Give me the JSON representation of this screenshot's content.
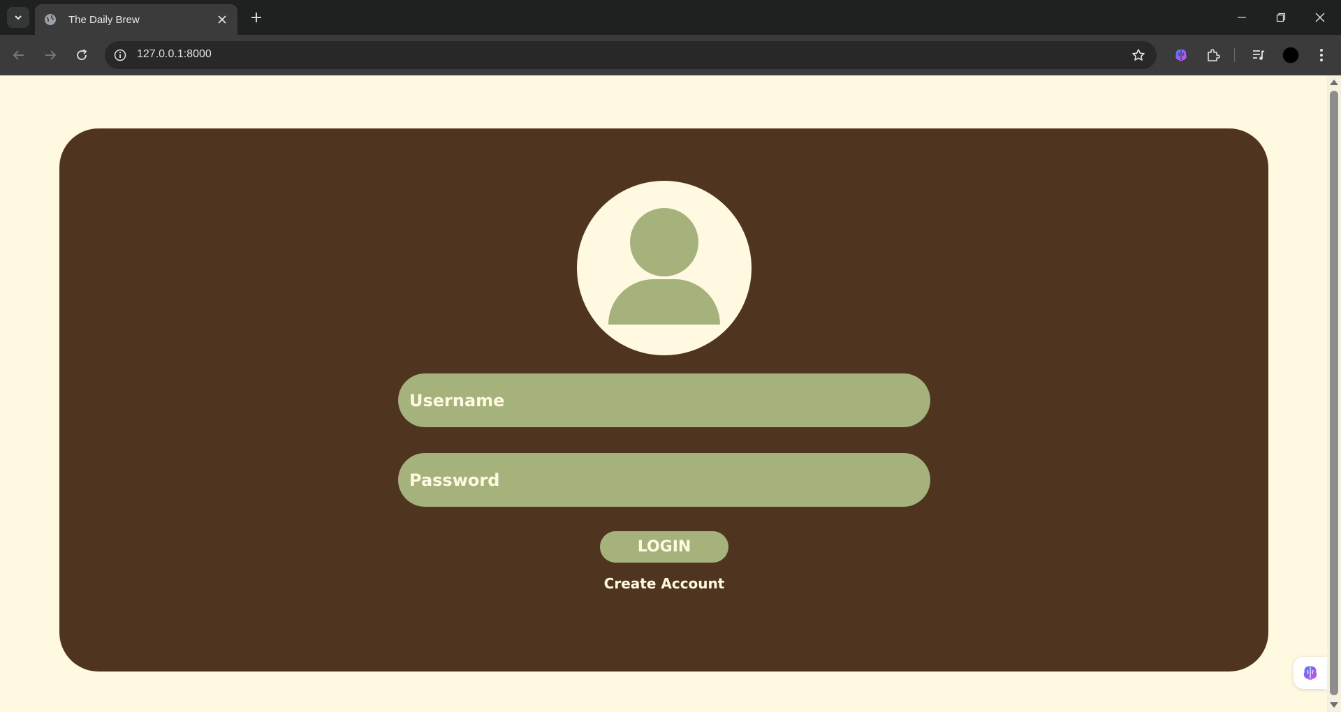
{
  "browser": {
    "tab_title": "The Daily Brew",
    "url": "127.0.0.1:8000",
    "icons": [
      "tab-search-icon",
      "globe-icon",
      "close-icon",
      "plus-icon",
      "minimize-icon",
      "restore-icon",
      "close-window-icon",
      "back-icon",
      "forward-icon",
      "reload-icon",
      "site-info-icon",
      "star-icon",
      "brain-extension-icon",
      "puzzle-icon",
      "media-control-icon",
      "profile-icon",
      "more-menu-icon"
    ]
  },
  "login": {
    "avatar_icon": "user-silhouette-icon",
    "username_placeholder": "Username",
    "password_placeholder": "Password",
    "login_label": "LOGIN",
    "create_account_label": "Create Account"
  },
  "floating_widget": {
    "icon": "brain-icon"
  },
  "colors": {
    "page_background": "#fff9e2",
    "card_background": "#4f3520",
    "accent_green": "#a5b27b",
    "text_cream": "#fff9e2",
    "chrome_dark": "#1f2020",
    "chrome_toolbar": "#3b3b3b"
  }
}
